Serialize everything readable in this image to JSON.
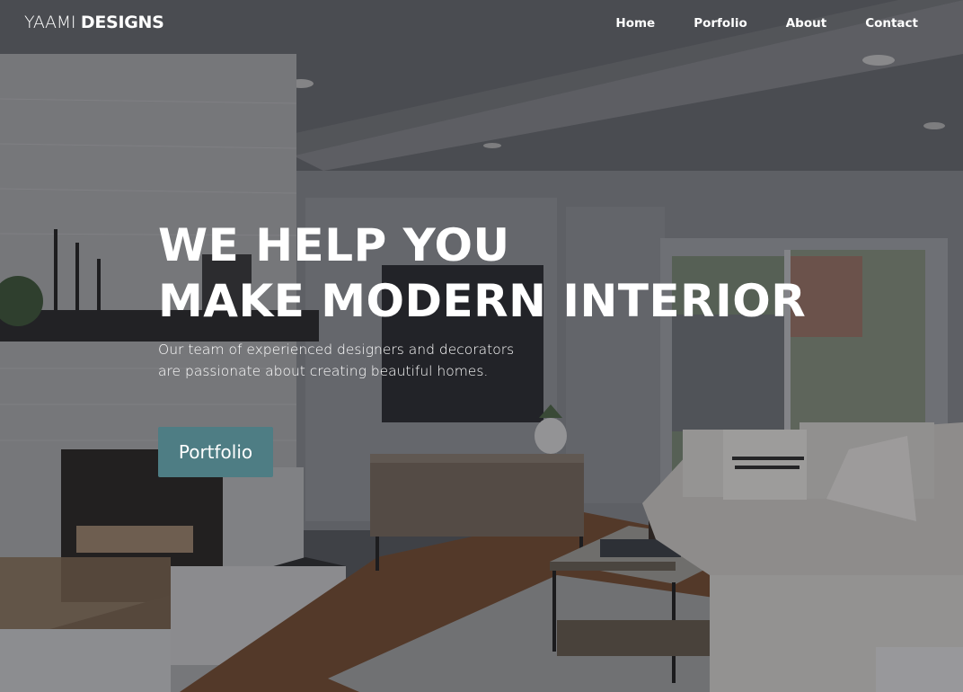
{
  "nav": {
    "logo_light": "YAAMI ",
    "logo_bold": "DESIGNS",
    "links": [
      "Home",
      "Porfolio",
      "About",
      "Contact"
    ]
  },
  "hero": {
    "headline_line1": "WE HELP YOU",
    "headline_line2": "MAKE MODERN INTERIOR",
    "subtext_line1": "Our team of experienced designers and decorators",
    "subtext_line2": "are passionate about creating beautiful homes.",
    "cta_label": "Portfolio"
  },
  "colors": {
    "cta_background": "#4e7d84",
    "text": "#ffffff"
  }
}
